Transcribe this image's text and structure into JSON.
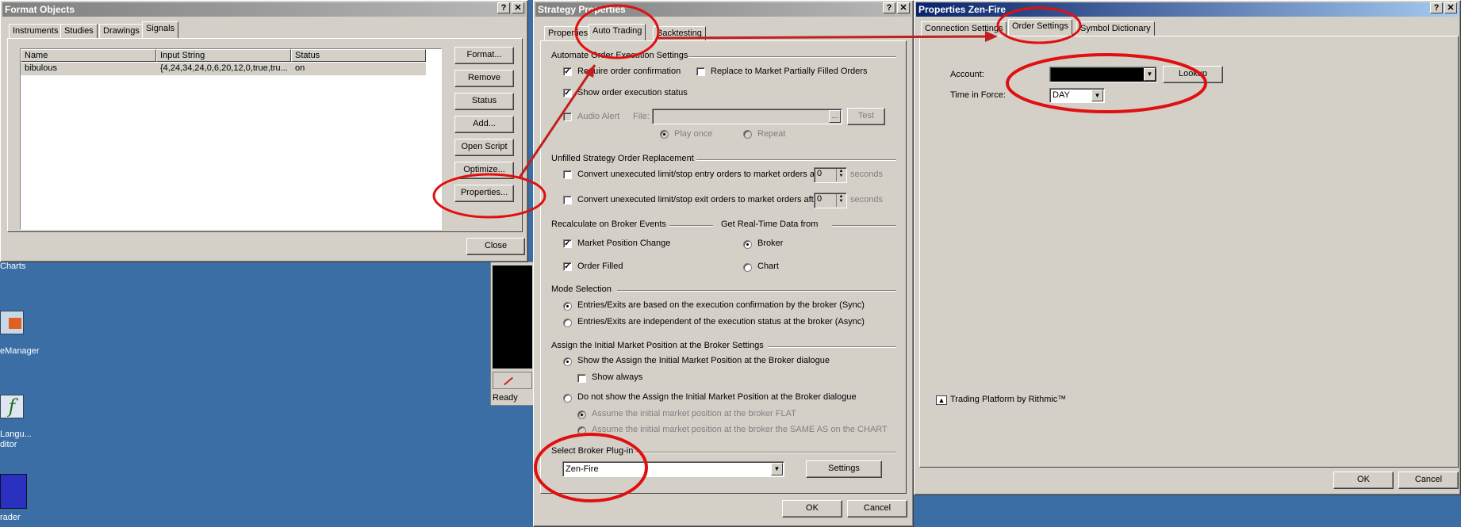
{
  "desktop": {
    "icons": [
      {
        "label": "Charts"
      },
      {
        "label": "eManager"
      },
      {
        "label": "Langu...",
        "label2": "ditor"
      },
      {
        "label": "rader"
      }
    ],
    "status": "Ready"
  },
  "format_objects": {
    "title": "Format Objects",
    "tabs": [
      "Instruments",
      "Studies",
      "Drawings",
      "Signals"
    ],
    "columns": [
      "Name",
      "Input String",
      "Status"
    ],
    "rows": [
      {
        "name": "bibulous",
        "input": "{4,24,34,24,0,6,20,12,0,true,tru...",
        "status": "on"
      }
    ],
    "buttons": [
      "Format...",
      "Remove",
      "Status",
      "Add...",
      "Open Script",
      "Optimize...",
      "Properties..."
    ],
    "close": "Close"
  },
  "strategy": {
    "title": "Strategy Properties",
    "tabs": [
      "Properties",
      "Auto Trading",
      "Backtesting"
    ],
    "sec1": "Automate Order Execution Settings",
    "require_conf": "Require order confirmation",
    "replace_market": "Replace to Market Partially Filled Orders",
    "show_status": "Show order execution status",
    "audio": "Audio Alert",
    "file": "File:",
    "test": "Test",
    "play_once": "Play once",
    "repeat": "Repeat",
    "sec2": "Unfilled Strategy Order Replacement",
    "conv_entry": "Convert unexecuted limit/stop entry orders to market orders after",
    "conv_exit": "Convert unexecuted limit/stop exit orders to market orders after",
    "spin_val": "0",
    "seconds": "seconds",
    "sec3": "Recalculate on Broker Events",
    "mpc": "Market Position Change",
    "order_filled": "Order Filled",
    "sec3b": "Get Real-Time Data from",
    "broker": "Broker",
    "chart": "Chart",
    "sec4": "Mode Selection",
    "sync": "Entries/Exits are based on the execution confirmation by the broker (Sync)",
    "async": "Entries/Exits are independent of the execution status at the broker (Async)",
    "sec5": "Assign the Initial Market Position at the Broker Settings",
    "show_assign": "Show the Assign the Initial Market Position at the Broker dialogue",
    "show_always": "Show always",
    "no_show": "Do not show the Assign the Initial Market Position at the Broker dialogue",
    "flat": "Assume the initial market position at the broker FLAT",
    "same": "Assume the initial market position at the broker the SAME AS on the CHART",
    "sec6": "Select Broker Plug-in",
    "plugin": "Zen-Fire",
    "settings": "Settings",
    "ok": "OK",
    "cancel": "Cancel"
  },
  "zen": {
    "title": "Properties Zen-Fire",
    "tabs": [
      "Connection Settings",
      "Order Settings",
      "Symbol Dictionary"
    ],
    "account": "Account:",
    "lookup": "Lookup",
    "tif": "Time in Force:",
    "tif_val": "DAY",
    "footer": "Trading Platform by Rithmic™",
    "ok": "OK",
    "cancel": "Cancel"
  },
  "colors": {
    "desktop": "#3a6ea5",
    "annotation": "#e01010"
  }
}
